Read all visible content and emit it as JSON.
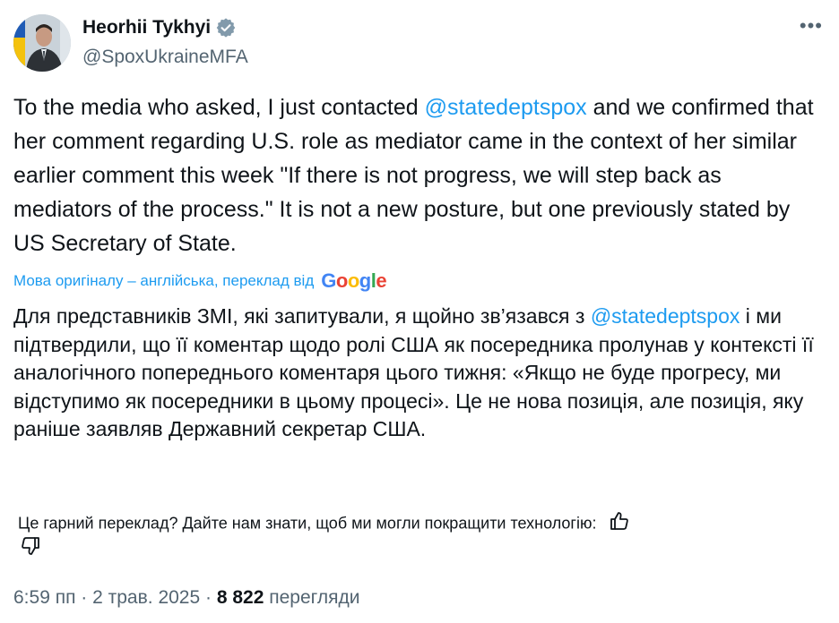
{
  "author": {
    "name": "Heorhii Tykhyi",
    "handle": "@SpoxUkraineMFA",
    "verified_color": "#829aab"
  },
  "more_menu": "•••",
  "tweet": {
    "text_before_mention": "To the media who asked, I just contacted ",
    "mention": "@statedeptspox",
    "text_after_mention": " and we confirmed that her comment regarding U.S. role as mediator came in the context of her similar earlier comment this week \"If there is not progress, we will step back as mediators of the process.\"  It is not a new posture, but one previously stated by US Secretary of State."
  },
  "translation": {
    "notice": "Мова оригіналу – англійська, переклад від",
    "provider_letters": [
      "G",
      "o",
      "o",
      "g",
      "l",
      "e"
    ],
    "text_before_mention": "Для представників ЗМІ, які запитували, я щойно зв’язався з ",
    "mention": "@statedeptspox",
    "text_after_mention": " і ми підтвердили, що її коментар щодо ролі США як посередника пролунав у контексті її аналогічного попереднього коментаря цього тижня: «Якщо не буде прогресу, ми відступимо як посередники в цьому процесі». Це не нова позиція, але позиція, яку раніше заявляв Державний секретар США."
  },
  "feedback": {
    "prompt": "Це гарний переклад? Дайте нам знати, щоб ми могли покращити технологію:",
    "up_icon": "thumbs-up-icon",
    "down_icon": "thumbs-down-icon"
  },
  "meta": {
    "time": "6:59 пп",
    "separator": " · ",
    "date": "2 трав. 2025",
    "views_count": "8 822",
    "views_label": " перегляди"
  },
  "colors": {
    "link": "#1d9bf0",
    "text": "#0f1419",
    "secondary": "#536471"
  }
}
